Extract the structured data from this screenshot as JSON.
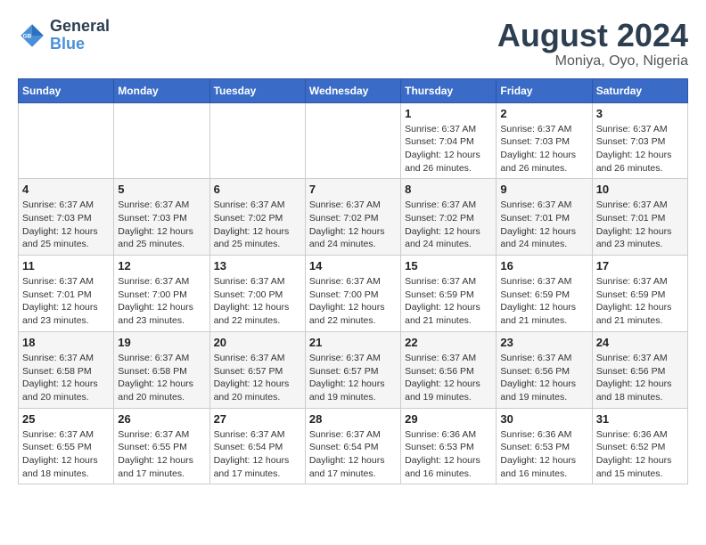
{
  "header": {
    "logo_line1": "General",
    "logo_line2": "Blue",
    "month_title": "August 2024",
    "location": "Moniya, Oyo, Nigeria"
  },
  "days_of_week": [
    "Sunday",
    "Monday",
    "Tuesday",
    "Wednesday",
    "Thursday",
    "Friday",
    "Saturday"
  ],
  "weeks": [
    [
      {
        "day": "",
        "text": ""
      },
      {
        "day": "",
        "text": ""
      },
      {
        "day": "",
        "text": ""
      },
      {
        "day": "",
        "text": ""
      },
      {
        "day": "1",
        "text": "Sunrise: 6:37 AM\nSunset: 7:04 PM\nDaylight: 12 hours\nand 26 minutes."
      },
      {
        "day": "2",
        "text": "Sunrise: 6:37 AM\nSunset: 7:03 PM\nDaylight: 12 hours\nand 26 minutes."
      },
      {
        "day": "3",
        "text": "Sunrise: 6:37 AM\nSunset: 7:03 PM\nDaylight: 12 hours\nand 26 minutes."
      }
    ],
    [
      {
        "day": "4",
        "text": "Sunrise: 6:37 AM\nSunset: 7:03 PM\nDaylight: 12 hours\nand 25 minutes."
      },
      {
        "day": "5",
        "text": "Sunrise: 6:37 AM\nSunset: 7:03 PM\nDaylight: 12 hours\nand 25 minutes."
      },
      {
        "day": "6",
        "text": "Sunrise: 6:37 AM\nSunset: 7:02 PM\nDaylight: 12 hours\nand 25 minutes."
      },
      {
        "day": "7",
        "text": "Sunrise: 6:37 AM\nSunset: 7:02 PM\nDaylight: 12 hours\nand 24 minutes."
      },
      {
        "day": "8",
        "text": "Sunrise: 6:37 AM\nSunset: 7:02 PM\nDaylight: 12 hours\nand 24 minutes."
      },
      {
        "day": "9",
        "text": "Sunrise: 6:37 AM\nSunset: 7:01 PM\nDaylight: 12 hours\nand 24 minutes."
      },
      {
        "day": "10",
        "text": "Sunrise: 6:37 AM\nSunset: 7:01 PM\nDaylight: 12 hours\nand 23 minutes."
      }
    ],
    [
      {
        "day": "11",
        "text": "Sunrise: 6:37 AM\nSunset: 7:01 PM\nDaylight: 12 hours\nand 23 minutes."
      },
      {
        "day": "12",
        "text": "Sunrise: 6:37 AM\nSunset: 7:00 PM\nDaylight: 12 hours\nand 23 minutes."
      },
      {
        "day": "13",
        "text": "Sunrise: 6:37 AM\nSunset: 7:00 PM\nDaylight: 12 hours\nand 22 minutes."
      },
      {
        "day": "14",
        "text": "Sunrise: 6:37 AM\nSunset: 7:00 PM\nDaylight: 12 hours\nand 22 minutes."
      },
      {
        "day": "15",
        "text": "Sunrise: 6:37 AM\nSunset: 6:59 PM\nDaylight: 12 hours\nand 21 minutes."
      },
      {
        "day": "16",
        "text": "Sunrise: 6:37 AM\nSunset: 6:59 PM\nDaylight: 12 hours\nand 21 minutes."
      },
      {
        "day": "17",
        "text": "Sunrise: 6:37 AM\nSunset: 6:59 PM\nDaylight: 12 hours\nand 21 minutes."
      }
    ],
    [
      {
        "day": "18",
        "text": "Sunrise: 6:37 AM\nSunset: 6:58 PM\nDaylight: 12 hours\nand 20 minutes."
      },
      {
        "day": "19",
        "text": "Sunrise: 6:37 AM\nSunset: 6:58 PM\nDaylight: 12 hours\nand 20 minutes."
      },
      {
        "day": "20",
        "text": "Sunrise: 6:37 AM\nSunset: 6:57 PM\nDaylight: 12 hours\nand 20 minutes."
      },
      {
        "day": "21",
        "text": "Sunrise: 6:37 AM\nSunset: 6:57 PM\nDaylight: 12 hours\nand 19 minutes."
      },
      {
        "day": "22",
        "text": "Sunrise: 6:37 AM\nSunset: 6:56 PM\nDaylight: 12 hours\nand 19 minutes."
      },
      {
        "day": "23",
        "text": "Sunrise: 6:37 AM\nSunset: 6:56 PM\nDaylight: 12 hours\nand 19 minutes."
      },
      {
        "day": "24",
        "text": "Sunrise: 6:37 AM\nSunset: 6:56 PM\nDaylight: 12 hours\nand 18 minutes."
      }
    ],
    [
      {
        "day": "25",
        "text": "Sunrise: 6:37 AM\nSunset: 6:55 PM\nDaylight: 12 hours\nand 18 minutes."
      },
      {
        "day": "26",
        "text": "Sunrise: 6:37 AM\nSunset: 6:55 PM\nDaylight: 12 hours\nand 17 minutes."
      },
      {
        "day": "27",
        "text": "Sunrise: 6:37 AM\nSunset: 6:54 PM\nDaylight: 12 hours\nand 17 minutes."
      },
      {
        "day": "28",
        "text": "Sunrise: 6:37 AM\nSunset: 6:54 PM\nDaylight: 12 hours\nand 17 minutes."
      },
      {
        "day": "29",
        "text": "Sunrise: 6:36 AM\nSunset: 6:53 PM\nDaylight: 12 hours\nand 16 minutes."
      },
      {
        "day": "30",
        "text": "Sunrise: 6:36 AM\nSunset: 6:53 PM\nDaylight: 12 hours\nand 16 minutes."
      },
      {
        "day": "31",
        "text": "Sunrise: 6:36 AM\nSunset: 6:52 PM\nDaylight: 12 hours\nand 15 minutes."
      }
    ]
  ]
}
